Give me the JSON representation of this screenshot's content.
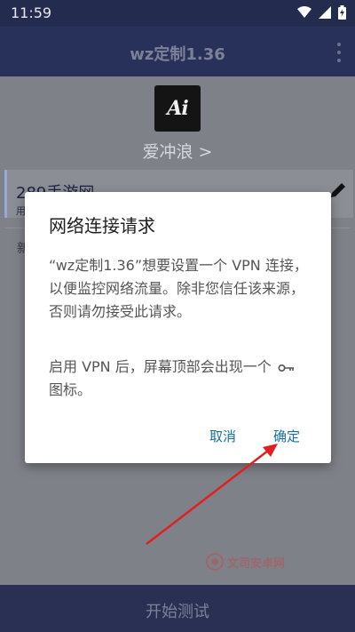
{
  "status_bar": {
    "time": "11:59"
  },
  "app_bar": {
    "title": "wz定制1.36"
  },
  "profile": {
    "logo_text": "Ai",
    "name": "爱冲浪 >"
  },
  "card": {
    "title": "289手游网",
    "subtitle_fragment": "用"
  },
  "row2": {
    "fragment": "新"
  },
  "dialog": {
    "title": "网络连接请求",
    "message": "“wz定制1.36”想要设置一个 VPN 连接，以便监控网络流量。除非您信任该来源，否则请勿接受此请求。",
    "message2_before": "启用 VPN 后，屏幕顶部会出现一个",
    "message2_after": "图标。",
    "cancel": "取消",
    "ok": "确定"
  },
  "bottom_button": {
    "label": "开始测试"
  },
  "watermark": {
    "text": "文司安卓网"
  },
  "colors": {
    "accent": "#177099",
    "annotation_arrow": "#e02020",
    "app_bar": "#283159"
  }
}
